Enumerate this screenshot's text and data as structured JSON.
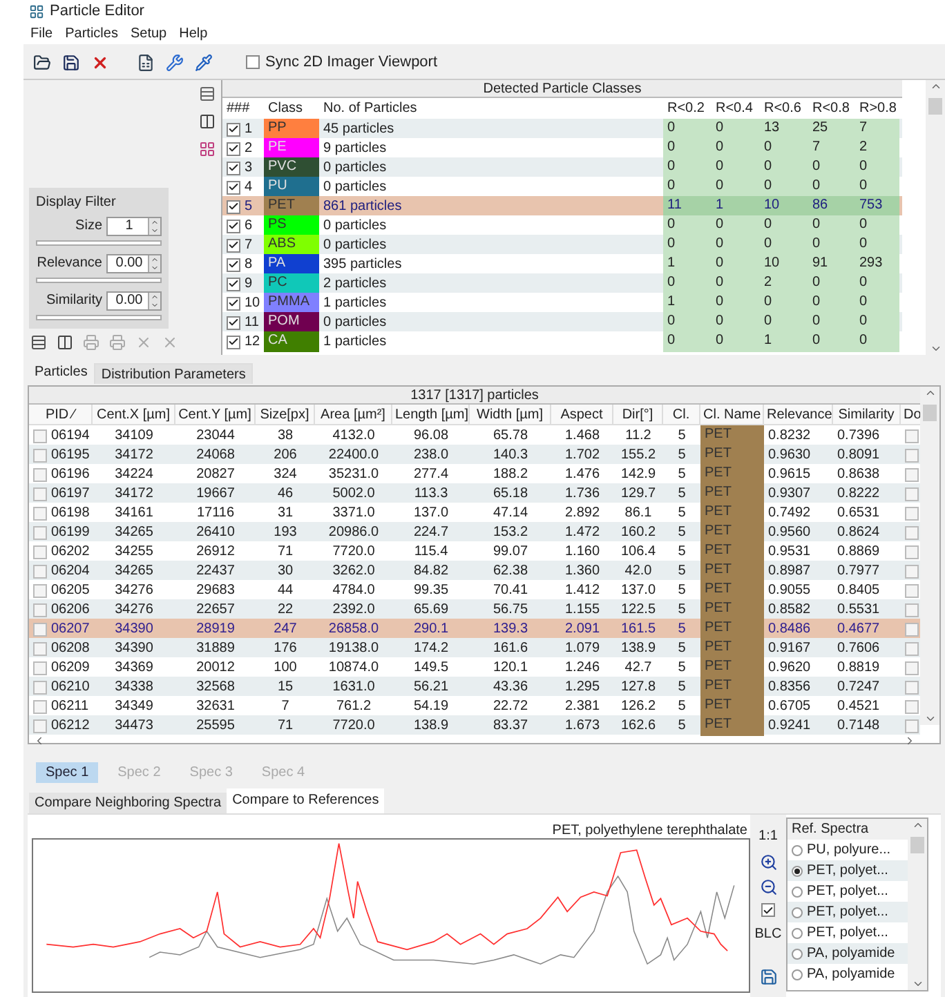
{
  "window": {
    "title": "Particle Editor"
  },
  "menu": [
    "File",
    "Particles",
    "Setup",
    "Help"
  ],
  "sync": {
    "label": "Sync 2D Imager Viewport",
    "checked": false
  },
  "display_filter": {
    "title": "Display Filter",
    "fields": [
      {
        "label": "Size",
        "value": "1"
      },
      {
        "label": "Relevance",
        "value": "0.00"
      },
      {
        "label": "Similarity",
        "value": "0.00"
      }
    ]
  },
  "class_table": {
    "title": "Detected Particle Classes",
    "columns": [
      "###",
      "Class",
      "No. of Particles",
      "R<0.2",
      "R<0.4",
      "R<0.6",
      "R<0.8",
      "R>0.8"
    ],
    "rows": [
      {
        "index": "1",
        "checked": true,
        "class": "PP",
        "color": "#ff7f3f",
        "count": "45 particles",
        "r": [
          "0",
          "0",
          "13",
          "25",
          "7"
        ],
        "selected": false
      },
      {
        "index": "2",
        "checked": true,
        "class": "PE",
        "color": "#ff00ff",
        "count": "9 particles",
        "r": [
          "0",
          "0",
          "0",
          "7",
          "2"
        ],
        "selected": false
      },
      {
        "index": "3",
        "checked": true,
        "class": "PVC",
        "color": "#2f4f33",
        "count": "0 particles",
        "r": [
          "0",
          "0",
          "0",
          "0",
          "0"
        ],
        "selected": false
      },
      {
        "index": "4",
        "checked": true,
        "class": "PU",
        "color": "#1f6f8f",
        "count": "0 particles",
        "r": [
          "0",
          "0",
          "0",
          "0",
          "0"
        ],
        "selected": false
      },
      {
        "index": "5",
        "checked": true,
        "class": "PET",
        "color": "#a08050",
        "count": "861 particles",
        "r": [
          "11",
          "1",
          "10",
          "86",
          "753"
        ],
        "selected": true
      },
      {
        "index": "6",
        "checked": true,
        "class": "PS",
        "color": "#00ff00",
        "count": "0 particles",
        "r": [
          "0",
          "0",
          "0",
          "0",
          "0"
        ],
        "selected": false
      },
      {
        "index": "7",
        "checked": true,
        "class": "ABS",
        "color": "#7fff00",
        "count": "0 particles",
        "r": [
          "0",
          "0",
          "0",
          "0",
          "0"
        ],
        "selected": false
      },
      {
        "index": "8",
        "checked": true,
        "class": "PA",
        "color": "#1040d0",
        "count": "395 particles",
        "r": [
          "1",
          "0",
          "10",
          "91",
          "293"
        ],
        "selected": false
      },
      {
        "index": "9",
        "checked": true,
        "class": "PC",
        "color": "#10c8b8",
        "count": "2 particles",
        "r": [
          "0",
          "0",
          "2",
          "0",
          "0"
        ],
        "selected": false
      },
      {
        "index": "10",
        "checked": true,
        "class": "PMMA",
        "color": "#8080ff",
        "count": "1 particles",
        "r": [
          "1",
          "0",
          "0",
          "0",
          "0"
        ],
        "selected": false
      },
      {
        "index": "11",
        "checked": true,
        "class": "POM",
        "color": "#700050",
        "count": "0 particles",
        "r": [
          "0",
          "0",
          "0",
          "0",
          "0"
        ],
        "selected": false
      },
      {
        "index": "12",
        "checked": true,
        "class": "CA",
        "color": "#407f00",
        "count": "1 particles",
        "r": [
          "0",
          "0",
          "1",
          "0",
          "0"
        ],
        "selected": false
      }
    ]
  },
  "tabs": [
    {
      "label": "Particles",
      "selected": true
    },
    {
      "label": "Distribution Parameters",
      "selected": false
    }
  ],
  "particle_table": {
    "title": "1317 [1317] particles",
    "columns": [
      "PID ⁄",
      "Cent.X [µm]",
      "Cent.Y [µm]",
      "Size[px]",
      "Area [µm²]",
      "Length [µm]",
      "Width [µm]",
      "Aspect",
      "Dir[°]",
      "Cl.",
      "Cl. Name",
      "Relevance",
      "Similarity",
      "Do"
    ],
    "rows": [
      {
        "checked": false,
        "selected": false,
        "cells": [
          "06194",
          "34109",
          "23044",
          "38",
          "4132.0",
          "96.08",
          "65.78",
          "1.468",
          "11.2",
          "5",
          "PET",
          "0.8232",
          "0.7396"
        ],
        "done": false
      },
      {
        "checked": false,
        "selected": false,
        "cells": [
          "06195",
          "34172",
          "24068",
          "206",
          "22400.0",
          "238.0",
          "140.3",
          "1.702",
          "155.2",
          "5",
          "PET",
          "0.9630",
          "0.8091"
        ],
        "done": false
      },
      {
        "checked": false,
        "selected": false,
        "cells": [
          "06196",
          "34224",
          "20827",
          "324",
          "35231.0",
          "277.4",
          "188.2",
          "1.476",
          "142.9",
          "5",
          "PET",
          "0.9615",
          "0.8638"
        ],
        "done": false
      },
      {
        "checked": false,
        "selected": false,
        "cells": [
          "06197",
          "34172",
          "19667",
          "46",
          "5002.0",
          "113.3",
          "65.18",
          "1.736",
          "129.7",
          "5",
          "PET",
          "0.9307",
          "0.8222"
        ],
        "done": false
      },
      {
        "checked": false,
        "selected": false,
        "cells": [
          "06198",
          "34161",
          "17116",
          "31",
          "3371.0",
          "137.0",
          "47.14",
          "2.892",
          "86.1",
          "5",
          "PET",
          "0.7492",
          "0.6531"
        ],
        "done": false
      },
      {
        "checked": false,
        "selected": false,
        "cells": [
          "06199",
          "34265",
          "26410",
          "193",
          "20986.0",
          "224.7",
          "153.2",
          "1.472",
          "160.2",
          "5",
          "PET",
          "0.9560",
          "0.8624"
        ],
        "done": false
      },
      {
        "checked": false,
        "selected": false,
        "cells": [
          "06202",
          "34255",
          "26912",
          "71",
          "7720.0",
          "115.4",
          "99.07",
          "1.160",
          "106.4",
          "5",
          "PET",
          "0.9531",
          "0.8869"
        ],
        "done": false
      },
      {
        "checked": false,
        "selected": false,
        "cells": [
          "06204",
          "34265",
          "22437",
          "30",
          "3262.0",
          "84.82",
          "62.38",
          "1.360",
          "42.0",
          "5",
          "PET",
          "0.8987",
          "0.7977"
        ],
        "done": false
      },
      {
        "checked": false,
        "selected": false,
        "cells": [
          "06205",
          "34276",
          "29683",
          "44",
          "4784.0",
          "99.35",
          "70.41",
          "1.412",
          "137.0",
          "5",
          "PET",
          "0.9055",
          "0.8405"
        ],
        "done": false
      },
      {
        "checked": false,
        "selected": false,
        "cells": [
          "06206",
          "34276",
          "22657",
          "22",
          "2392.0",
          "65.69",
          "56.75",
          "1.155",
          "122.5",
          "5",
          "PET",
          "0.8582",
          "0.5531"
        ],
        "done": false
      },
      {
        "checked": false,
        "selected": true,
        "cells": [
          "06207",
          "34390",
          "28919",
          "247",
          "26858.0",
          "290.1",
          "139.3",
          "2.091",
          "161.5",
          "5",
          "PET",
          "0.8486",
          "0.4677"
        ],
        "done": false
      },
      {
        "checked": false,
        "selected": false,
        "cells": [
          "06208",
          "34390",
          "31889",
          "176",
          "19138.0",
          "174.2",
          "161.6",
          "1.079",
          "138.9",
          "5",
          "PET",
          "0.9167",
          "0.7606"
        ],
        "done": false
      },
      {
        "checked": false,
        "selected": false,
        "cells": [
          "06209",
          "34369",
          "20012",
          "100",
          "10874.0",
          "149.5",
          "120.1",
          "1.246",
          "42.7",
          "5",
          "PET",
          "0.9620",
          "0.8819"
        ],
        "done": false
      },
      {
        "checked": false,
        "selected": false,
        "cells": [
          "06210",
          "34338",
          "32568",
          "15",
          "1631.0",
          "56.21",
          "43.36",
          "1.295",
          "127.8",
          "5",
          "PET",
          "0.8356",
          "0.7247"
        ],
        "done": false
      },
      {
        "checked": false,
        "selected": false,
        "cells": [
          "06211",
          "34349",
          "32631",
          "7",
          "761.2",
          "54.19",
          "22.72",
          "2.381",
          "126.2",
          "5",
          "PET",
          "0.6705",
          "0.4521"
        ],
        "done": false
      },
      {
        "checked": false,
        "selected": false,
        "cells": [
          "06212",
          "34473",
          "25595",
          "71",
          "7720.0",
          "138.9",
          "83.37",
          "1.673",
          "162.6",
          "5",
          "PET",
          "0.9241",
          "0.7148"
        ],
        "done": false
      }
    ]
  },
  "spec_tabs": [
    {
      "label": "Spec 1",
      "selected": true
    },
    {
      "label": "Spec 2",
      "selected": false
    },
    {
      "label": "Spec 3",
      "selected": false
    },
    {
      "label": "Spec 4",
      "selected": false
    }
  ],
  "compare_tabs": [
    {
      "label": "Compare Neighboring Spectra",
      "selected": false
    },
    {
      "label": "Compare to References",
      "selected": true
    }
  ],
  "spectrum": {
    "title": "PET, polyethylene terephthalate",
    "scale_label": "1:1",
    "blc": {
      "label": "BLC",
      "checked": true
    }
  },
  "ref_spectra": {
    "title": "Ref. Spectra",
    "items": [
      {
        "label": "PU, polyure...",
        "selected": false
      },
      {
        "label": "PET, polyet...",
        "selected": true
      },
      {
        "label": "PET, polyet...",
        "selected": false
      },
      {
        "label": "PET, polyet...",
        "selected": false
      },
      {
        "label": "PET, polyet...",
        "selected": false
      },
      {
        "label": "PA, polyamide",
        "selected": false
      },
      {
        "label": "PA, polyamide",
        "selected": false
      }
    ]
  }
}
